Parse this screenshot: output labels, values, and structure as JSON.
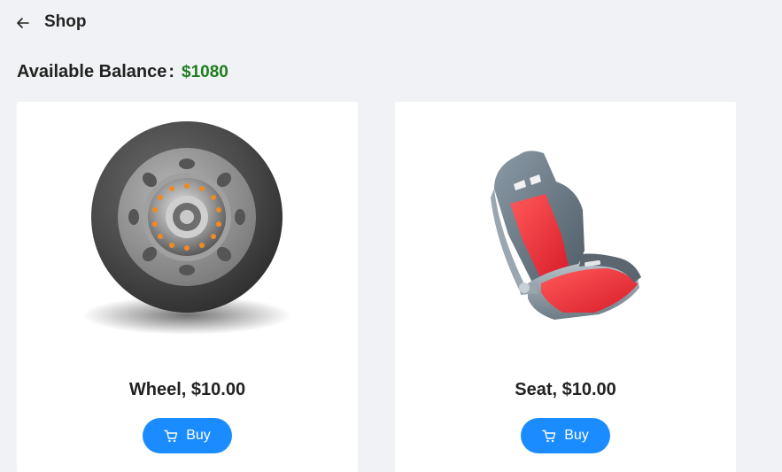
{
  "header": {
    "back_icon": "arrow-left-icon",
    "title": "Shop"
  },
  "balance": {
    "label": "Available Balance",
    "colon": ":",
    "value": "$1080",
    "value_color": "#1e7d1e"
  },
  "items": [
    {
      "image": "wheel-icon",
      "name": "Wheel, $10.00",
      "buy_label": "Buy",
      "buy_icon": "cart-icon"
    },
    {
      "image": "seat-icon",
      "name": "Seat, $10.00",
      "buy_label": "Buy",
      "buy_icon": "cart-icon"
    }
  ],
  "colors": {
    "accent": "#1a8cff",
    "background": "#f1f2f5",
    "card": "#ffffff"
  }
}
